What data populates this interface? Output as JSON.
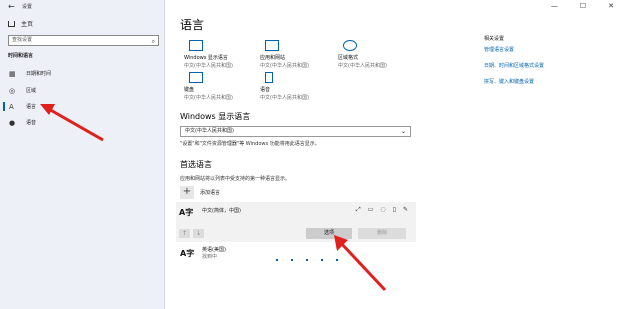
{
  "window": {
    "title": "设置",
    "back_glyph": "←",
    "min": "—",
    "max": "☐",
    "close": "✕"
  },
  "sidebar": {
    "home": "主页",
    "search_placeholder": "查找设置",
    "section_title": "时间和语言",
    "items": [
      {
        "label": "日期和时间",
        "icon": "calendar-icon",
        "glyph": "▦"
      },
      {
        "label": "区域",
        "icon": "globe-icon",
        "glyph": "◎"
      },
      {
        "label": "语言",
        "icon": "language-icon",
        "glyph": "A"
      },
      {
        "label": "语音",
        "icon": "microphone-icon",
        "glyph": "●"
      }
    ]
  },
  "main": {
    "title": "语言",
    "tiles": [
      {
        "label": "Windows 显示语言",
        "sub": "中文(中华人民共和国)",
        "icon": "monitor-icon"
      },
      {
        "label": "应用和网站",
        "sub": "中文(中华人民共和国)",
        "icon": "browser-icon"
      },
      {
        "label": "区域格式",
        "sub": "中文(中华人民共和国)",
        "icon": "region-format-icon"
      },
      {
        "label": "键盘",
        "sub": "中文(中华人民共和国)",
        "icon": "keyboard-icon"
      },
      {
        "label": "语音",
        "sub": "中文(中华人民共和国)",
        "icon": "speech-icon"
      }
    ],
    "related": {
      "head": "相关设置",
      "links": [
        "管理语言设置",
        "日期、时间和区域格式设置",
        "拼写、键入和键盘设置"
      ]
    },
    "display_lang_heading": "Windows 显示语言",
    "display_lang_value": "中文(中华人民共和国)",
    "display_lang_note": "\"设置\"和\"文件资源管理器\"等 Windows 功能将用此语言显示。",
    "preferred_heading": "首选语言",
    "preferred_desc": "应用和网站将以列表中受支持的第一种语言显示。",
    "add_language": "添加语言",
    "languages": [
      {
        "name": "中文(简体，中国)",
        "icon_glyph": "A字"
      },
      {
        "name": "英语(美国)",
        "sub": "找到中",
        "icon_glyph": "A字"
      }
    ],
    "options_button": "选项",
    "remove_button": "删除",
    "up_glyph": "↑",
    "down_glyph": "↓",
    "colors": {
      "accent": "#0063b1",
      "annotation": "#e0201c"
    }
  }
}
